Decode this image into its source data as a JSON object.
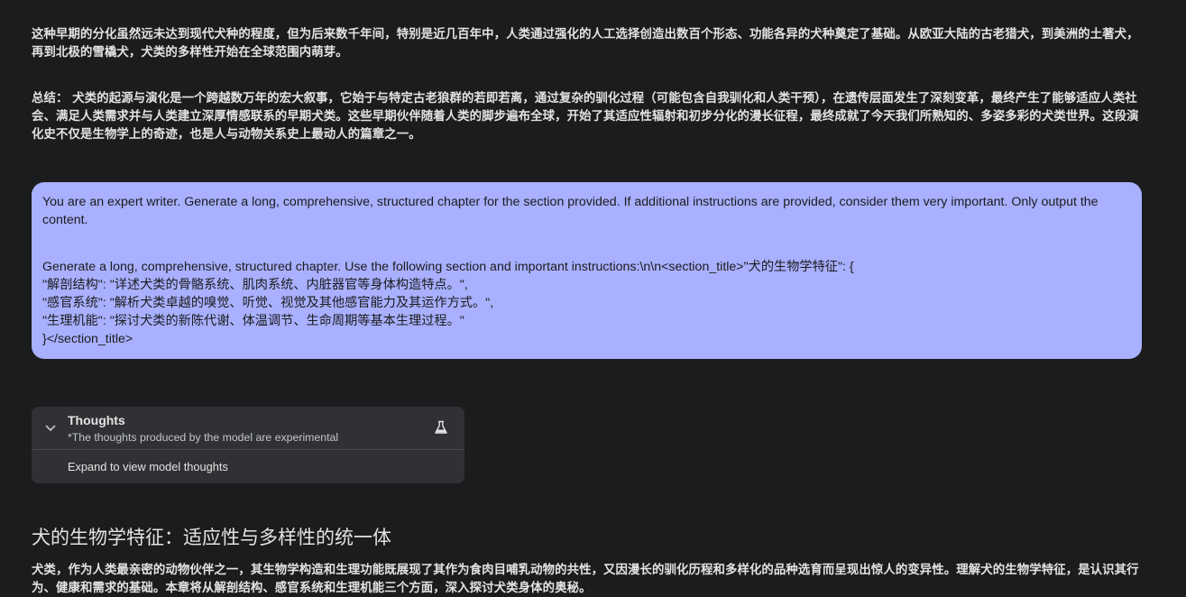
{
  "response_top": {
    "para1": "这种早期的分化虽然远未达到现代犬种的程度，但为后来数千年间，特别是近几百年中，人类通过强化的人工选择创造出数百个形态、功能各异的犬种奠定了基础。从欧亚大陆的古老猎犬，到美洲的土著犬，再到北极的雪橇犬，犬类的多样性开始在全球范围内萌芽。",
    "summary_label": "总结：",
    "summary_text": " 犬类的起源与演化是一个跨越数万年的宏大叙事，它始于与特定古老狼群的若即若离，通过复杂的驯化过程（可能包含自我驯化和人类干预），在遗传层面发生了深刻变革，最终产生了能够适应人类社会、满足人类需求并与人类建立深厚情感联系的早期犬类。这些早期伙伴随着人类的脚步遍布全球，开始了其适应性辐射和初步分化的漫长征程，最终成就了今天我们所熟知的、多姿多彩的犬类世界。这段演化史不仅是生物学上的奇迹，也是人与动物关系史上最动人的篇章之一。"
  },
  "user_prompt": {
    "intro": "You are an expert writer. Generate a long, comprehensive, structured chapter for the section provided. If additional instructions are provided, consider them very important. Only output the content.",
    "line1": "Generate a long, comprehensive, structured chapter. Use the following section and important instructions:\\n\\n<section_title>\"犬的生物学特征\": {",
    "line2": "\"解剖结构\": \"详述犬类的骨骼系统、肌肉系统、内脏器官等身体构造特点。\",",
    "line3": "\"感官系统\": \"解析犬类卓越的嗅觉、听觉、视觉及其他感官能力及其运作方式。\",",
    "line4": "\"生理机能\": \"探讨犬类的新陈代谢、体温调节、生命周期等基本生理过程。\"",
    "line5": "}</section_title>"
  },
  "thoughts": {
    "title": "Thoughts",
    "subtitle": "*The thoughts produced by the model are experimental",
    "expand_label": "Expand to view model thoughts",
    "chevron_icon": "chevron-down-icon",
    "flask_icon": "flask-icon"
  },
  "response_bottom": {
    "heading": "犬的生物学特征：适应性与多样性的统一体",
    "para": "犬类，作为人类最亲密的动物伙伴之一，其生物学构造和生理功能既展现了其作为食肉目哺乳动物的共性，又因漫长的驯化历程和多样化的品种选育而呈现出惊人的变异性。理解犬的生物学特征，是认识其行为、健康和需求的基础。本章将从解剖结构、感官系统和生理机能三个方面，深入探讨犬类身体的奥秘。"
  },
  "colors": {
    "background": "#1b1c1d",
    "bubble": "#a8b0ff",
    "thoughts_panel": "#303134",
    "text": "#e3e3e3"
  }
}
